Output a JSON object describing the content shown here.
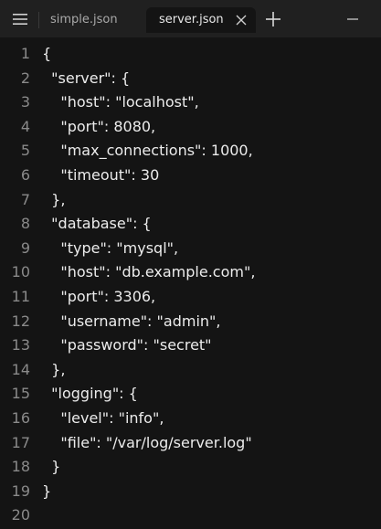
{
  "tabs": [
    {
      "label": "simple.json",
      "active": false
    },
    {
      "label": "server.json",
      "active": true
    }
  ],
  "icons": {
    "menu": "hamburger-menu-icon",
    "close": "close-icon",
    "new_tab": "plus-icon",
    "minimize": "minimize-icon"
  },
  "colors": {
    "editor_bg": "#141414",
    "tabbar_bg": "#202020",
    "text": "#ececec",
    "line_number": "#8a8a8a"
  },
  "editor": {
    "lines": [
      "{",
      "  \"server\": {",
      "    \"host\": \"localhost\",",
      "    \"port\": 8080,",
      "    \"max_connections\": 1000,",
      "    \"timeout\": 30",
      "  },",
      "  \"database\": {",
      "    \"type\": \"mysql\",",
      "    \"host\": \"db.example.com\",",
      "    \"port\": 3306,",
      "    \"username\": \"admin\",",
      "    \"password\": \"secret\"",
      "  },",
      "  \"logging\": {",
      "    \"level\": \"info\",",
      "    \"file\": \"/var/log/server.log\"",
      "  }",
      "}",
      ""
    ]
  }
}
